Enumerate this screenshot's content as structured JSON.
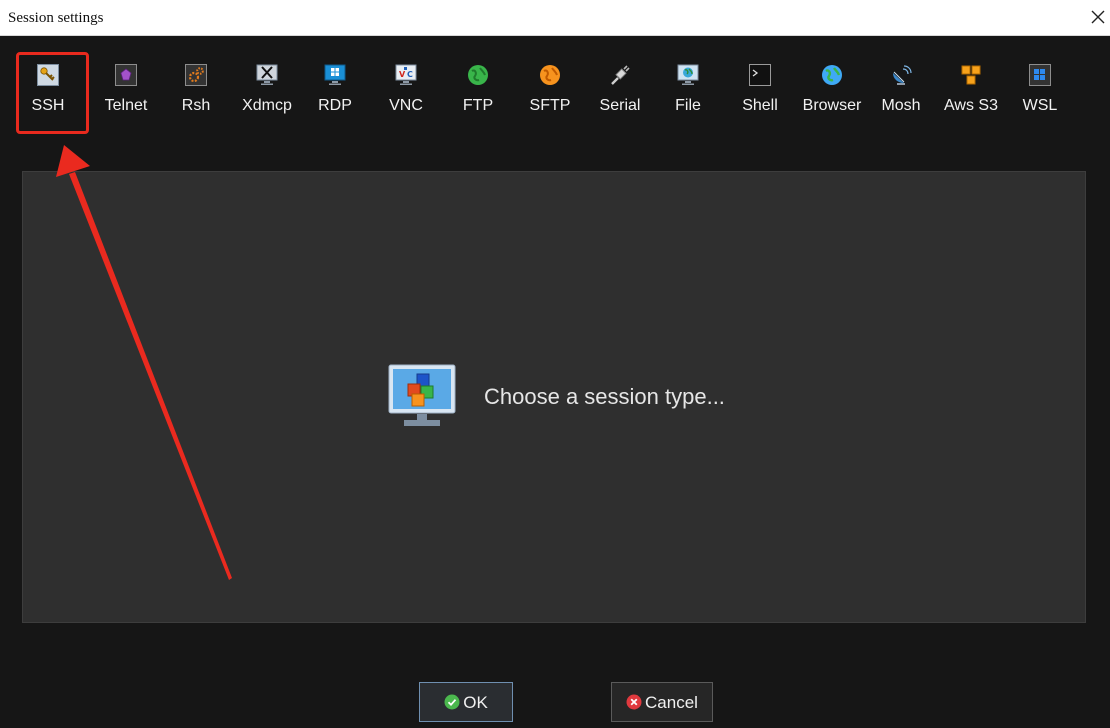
{
  "window": {
    "title": "Session settings",
    "close_icon": "close-icon"
  },
  "session_types": [
    {
      "key": "ssh",
      "label": "SSH",
      "icon": "key-icon",
      "selected": true
    },
    {
      "key": "telnet",
      "label": "Telnet",
      "icon": "telnet-icon"
    },
    {
      "key": "rsh",
      "label": "Rsh",
      "icon": "gears-icon"
    },
    {
      "key": "xdmcp",
      "label": "Xdmcp",
      "icon": "x-monitor-icon"
    },
    {
      "key": "rdp",
      "label": "RDP",
      "icon": "windows-monitor-icon"
    },
    {
      "key": "vnc",
      "label": "VNC",
      "icon": "vnc-icon"
    },
    {
      "key": "ftp",
      "label": "FTP",
      "icon": "green-globe-icon"
    },
    {
      "key": "sftp",
      "label": "SFTP",
      "icon": "orange-globe-icon"
    },
    {
      "key": "serial",
      "label": "Serial",
      "icon": "serial-plug-icon"
    },
    {
      "key": "file",
      "label": "File",
      "icon": "file-monitor-icon"
    },
    {
      "key": "shell",
      "label": "Shell",
      "icon": "terminal-icon"
    },
    {
      "key": "browser",
      "label": "Browser",
      "icon": "globe-icon"
    },
    {
      "key": "mosh",
      "label": "Mosh",
      "icon": "satellite-dish-icon"
    },
    {
      "key": "awss3",
      "label": "Aws S3",
      "icon": "cubes-icon"
    },
    {
      "key": "wsl",
      "label": "WSL",
      "icon": "windows-icon"
    }
  ],
  "panel": {
    "prompt": "Choose a session type...",
    "icon": "session-monitor-icon"
  },
  "buttons": {
    "ok_label": "OK",
    "cancel_label": "Cancel"
  },
  "colors": {
    "highlight": "#e82a1e",
    "background": "#161616",
    "panel": "#2f2f2f"
  }
}
